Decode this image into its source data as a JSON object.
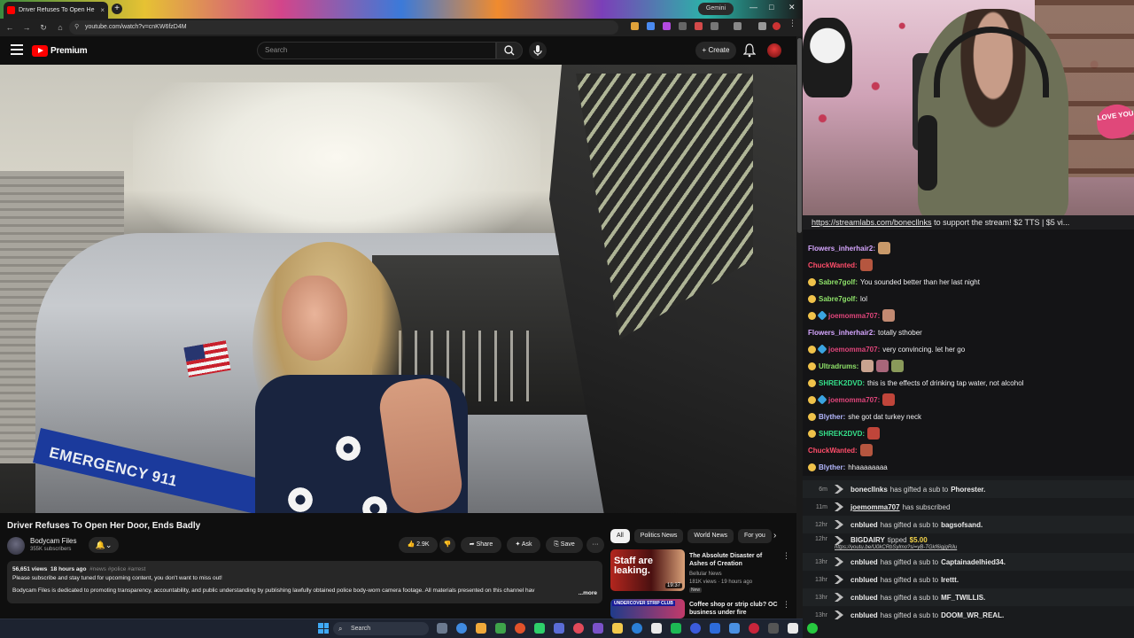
{
  "browser": {
    "tab_title": "Driver Refuses To Open He",
    "url": "youtube.com/watch?v=cnKW6fzD4M",
    "gemini_label": "Gemini",
    "new_tab_glyph": "+",
    "tab_close_glyph": "×"
  },
  "youtube": {
    "logo_text": "Premium",
    "search_placeholder": "Search",
    "create_label": "+ Create",
    "video_overlay_text": "EMERGENCY 911",
    "video_title": "Driver Refuses To Open Her Door, Ends Badly",
    "channel_name": "Bodycam Files",
    "channel_subs": "355K subscribers",
    "likes": "2.9K",
    "share_label": "Share",
    "ask_label": "Ask",
    "save_label": "Save",
    "more_glyph": "···",
    "description": {
      "views": "56,651 views",
      "age": "18 hours ago",
      "tags": "#news #police #arrest",
      "line1": "Please subscribe and stay tuned for upcoming content, you don't want to miss out!",
      "line2": "Bodycam Files is dedicated to promoting transparency, accountability, and public understanding by publishing lawfully obtained police body-worn camera footage. All materials presented on this channel hav",
      "more": "...more"
    },
    "chips": [
      "All",
      "Politics News",
      "World News",
      "For you"
    ],
    "recommendations": [
      {
        "title": "The Absolute Disaster of Ashes of Creation",
        "channel": "Bellular News",
        "meta": "181K views · 19 hours ago",
        "badge": "New",
        "duration": "19:37",
        "thumb_text": "Staff are leaking."
      },
      {
        "title": "Coffee shop or strip club? OC business under fire",
        "channel": "",
        "meta": "",
        "badge": "",
        "duration": "",
        "thumb_text": "UNDERCOVER STRIP CLUB"
      }
    ]
  },
  "stream": {
    "ticker_link": "https://streamlabs.com/bonecllnks",
    "ticker_rest": " to support the stream! $2 TTS | $5 vi...",
    "love_you": "LOVE YOU",
    "chat": [
      {
        "badges": [],
        "user": "Flowers_inherhair2:",
        "color": "#d6a6ff",
        "text": "",
        "emotes": [
          "#c99a6a"
        ]
      },
      {
        "badges": [],
        "user": "ChuckWanted:",
        "color": "#ff4d6a",
        "text": "",
        "emotes": [
          "#b5563f"
        ]
      },
      {
        "badges": [
          "b1"
        ],
        "user": "Sabre7golf:",
        "color": "#8fe36a",
        "text": "You sounded better than her last night",
        "emotes": []
      },
      {
        "badges": [
          "b1"
        ],
        "user": "Sabre7golf:",
        "color": "#8fe36a",
        "text": "lol",
        "emotes": []
      },
      {
        "badges": [
          "b1",
          "b2"
        ],
        "user": "joemomma707:",
        "color": "#e0457b",
        "text": "",
        "emotes": [
          "#c28a72"
        ]
      },
      {
        "badges": [],
        "user": "Flowers_inherhair2:",
        "color": "#d6a6ff",
        "text": "totally sthober",
        "emotes": []
      },
      {
        "badges": [
          "b1",
          "b2"
        ],
        "user": "joemomma707:",
        "color": "#e0457b",
        "text": "very convincing. let her go",
        "emotes": []
      },
      {
        "badges": [
          "b1"
        ],
        "user": "Ultradrums:",
        "color": "#8fe36a",
        "text": "",
        "emotes": [
          "#c9a38f",
          "#a8667a",
          "#8a9a5a"
        ]
      },
      {
        "badges": [
          "b1"
        ],
        "user": "SHREK2DVD:",
        "color": "#35e08a",
        "text": "this is the effects of drinking tap water, not alcohol",
        "emotes": []
      },
      {
        "badges": [
          "b1",
          "b2"
        ],
        "user": "joemomma707:",
        "color": "#e0457b",
        "text": "",
        "emotes": [
          "#c0453a"
        ]
      },
      {
        "badges": [
          "b1"
        ],
        "user": "Blyther:",
        "color": "#b4b8ff",
        "text": "she got dat turkey neck",
        "emotes": []
      },
      {
        "badges": [
          "b1"
        ],
        "user": "SHREK2DVD:",
        "color": "#35e08a",
        "text": "",
        "emotes": [
          "#c0453a"
        ]
      },
      {
        "badges": [],
        "user": "ChuckWanted:",
        "color": "#ff4d6a",
        "text": "",
        "emotes": [
          "#b5563f"
        ]
      },
      {
        "badges": [
          "b1"
        ],
        "user": "Blyther:",
        "color": "#b4b8ff",
        "text": "hhaaaaaaaa",
        "emotes": []
      }
    ],
    "events": [
      {
        "time": "6m",
        "user": "bonecllnks",
        "action": "has gifted a sub to",
        "recipient": "Phorester.",
        "link": false
      },
      {
        "time": "11m",
        "user": "joemomma707",
        "action": "has subscribed",
        "recipient": "",
        "link": true
      },
      {
        "time": "12hr",
        "user": "cnblued",
        "action": "has gifted a sub to",
        "recipient": "bagsofsand.",
        "link": false
      },
      {
        "time": "12hr",
        "user": "BIGDAIRY",
        "action": "tipped",
        "recipient": "",
        "amount": "$5.00",
        "url": "https://youtu.be/U0kCRbSylmo?si=yB-TGkf6igjgRilu",
        "link": false
      },
      {
        "time": "13hr",
        "user": "cnblued",
        "action": "has gifted a sub to",
        "recipient": "Captainadelhied34.",
        "link": false
      },
      {
        "time": "13hr",
        "user": "cnblued",
        "action": "has gifted a sub to",
        "recipient": "Irettt.",
        "link": false
      },
      {
        "time": "13hr",
        "user": "cnblued",
        "action": "has gifted a sub to",
        "recipient": "MF_TWILLIS.",
        "link": false
      },
      {
        "time": "13hr",
        "user": "cnblued",
        "action": "has gifted a sub to",
        "recipient": "DOOM_WR_REAL.",
        "link": false
      }
    ]
  },
  "taskbar": {
    "search_placeholder": "Search",
    "icon_colors": [
      "#6b7a8f",
      "#3f8ae0",
      "#f0a93a",
      "#3ea34a",
      "#e0522a",
      "#2ecf6a",
      "#5a6cd6",
      "#e04a5a",
      "#7a52c9",
      "#f2c94c",
      "#2b7fd6",
      "#e9e9e9",
      "#1db954",
      "#3b5bdb",
      "#2d6bd9",
      "#4a90e2",
      "#c8253b",
      "#555",
      "#e9e9e9",
      "#27c93f"
    ]
  }
}
